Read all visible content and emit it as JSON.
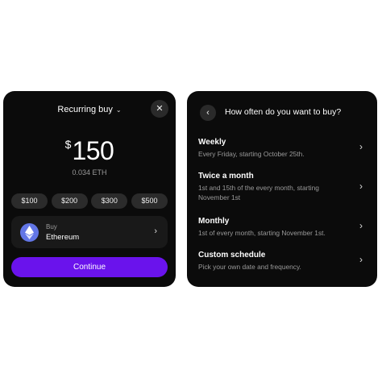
{
  "recurring": {
    "title": "Recurring buy",
    "currency_symbol": "$",
    "amount": "150",
    "eth_amount": "0.034 ETH",
    "presets": [
      "$100",
      "$200",
      "$300",
      "$500"
    ],
    "asset_action": "Buy",
    "asset_name": "Ethereum",
    "continue_label": "Continue",
    "accent_color": "#6a13ec"
  },
  "frequency": {
    "title": "How often do you want to buy?",
    "options": [
      {
        "title": "Weekly",
        "desc": "Every Friday, starting October 25th."
      },
      {
        "title": "Twice a month",
        "desc": "1st and 15th of the every month, starting November 1st"
      },
      {
        "title": "Monthly",
        "desc": "1st of every month, starting November 1st."
      },
      {
        "title": "Custom schedule",
        "desc": "Pick your own date and frequency."
      }
    ]
  }
}
